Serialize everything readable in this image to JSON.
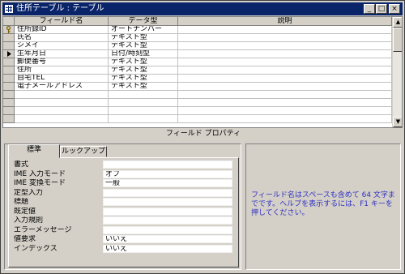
{
  "window": {
    "title": "住所テーブル : テーブル",
    "minimize_glyph": "_",
    "maximize_glyph": "□",
    "close_glyph": "×"
  },
  "grid": {
    "columns": {
      "field_name": "フィールド名",
      "data_type": "データ型",
      "description": "説明"
    },
    "rows": [
      {
        "marker": "key",
        "field": "住所録ID",
        "type": "オートナンバー"
      },
      {
        "marker": "",
        "field": "氏名",
        "type": "テキスト型"
      },
      {
        "marker": "",
        "field": "シメイ",
        "type": "テキスト型"
      },
      {
        "marker": "current",
        "field": "生年月日",
        "type": "日付/時刻型"
      },
      {
        "marker": "",
        "field": "郵便番号",
        "type": "テキスト型"
      },
      {
        "marker": "",
        "field": "住所",
        "type": "テキスト型"
      },
      {
        "marker": "",
        "field": "自宅TEL",
        "type": "テキスト型"
      },
      {
        "marker": "",
        "field": "電子メールアドレス",
        "type": "テキスト型"
      }
    ],
    "empty_rows": 4
  },
  "section_title": "フィールド プロパティ",
  "tabs": {
    "standard": "標準",
    "lookup": "ルックアップ"
  },
  "properties": [
    {
      "label": "書式",
      "value": ""
    },
    {
      "label": "IME 入力モード",
      "value": "オフ"
    },
    {
      "label": "IME 変換モード",
      "value": "一般"
    },
    {
      "label": "定型入力",
      "value": ""
    },
    {
      "label": "標題",
      "value": ""
    },
    {
      "label": "既定値",
      "value": ""
    },
    {
      "label": "入力規則",
      "value": ""
    },
    {
      "label": "エラーメッセージ",
      "value": ""
    },
    {
      "label": "値要求",
      "value": "いいえ"
    },
    {
      "label": "インデックス",
      "value": "いいえ"
    }
  ],
  "help_text": "フィールド名はスペースも含めて 64 文字までです。ヘルプを表示するには、F1 キーを押してください。",
  "icons": {
    "key": "key-icon",
    "current": "row-pointer-icon"
  }
}
